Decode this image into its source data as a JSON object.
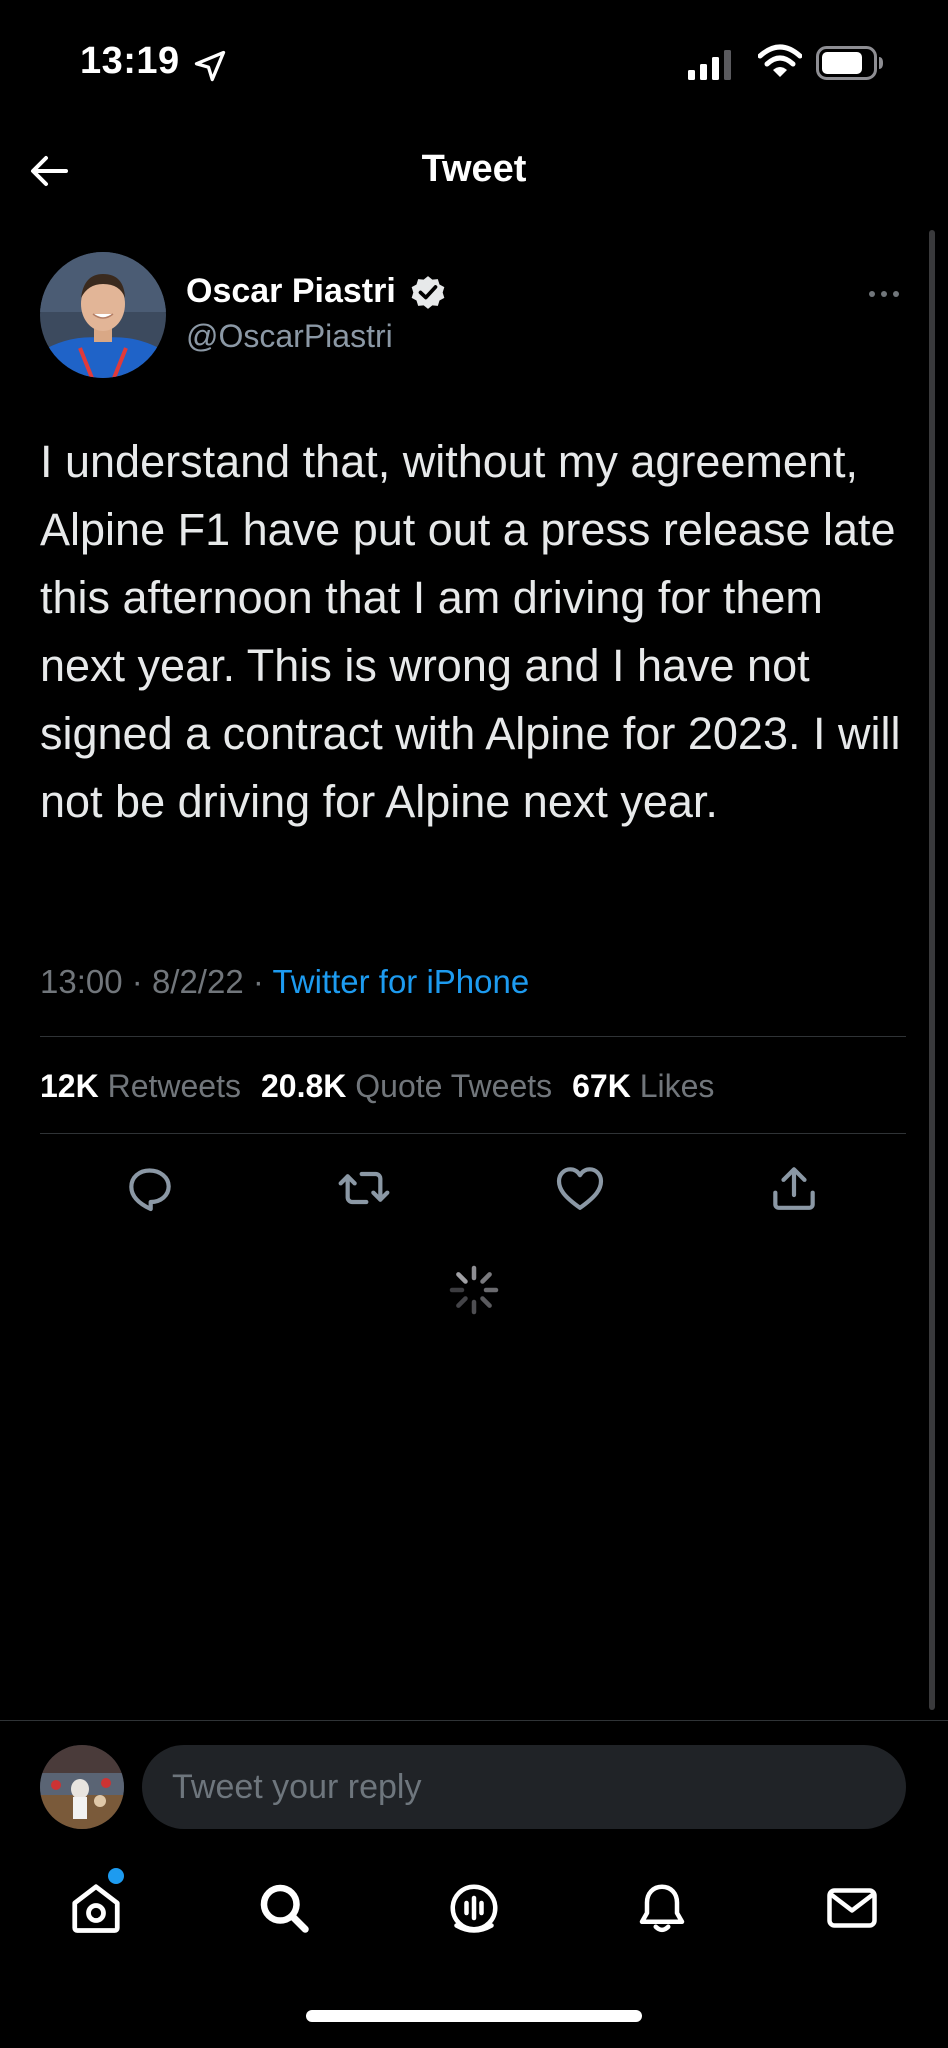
{
  "status_bar": {
    "time": "13:19",
    "icons": [
      "location-arrow-icon",
      "signal-icon",
      "wifi-icon",
      "battery-icon"
    ]
  },
  "nav": {
    "title": "Tweet",
    "back_icon": "back-arrow-icon"
  },
  "tweet": {
    "author_name": "Oscar Piastri",
    "handle": "@OscarPiastri",
    "verified": true,
    "text": "I understand that, without my agreement, Alpine F1 have put out a press release late this afternoon that I am driving for them next year. This is wrong and I have not signed a contract with Alpine for 2023. I will not be driving for Alpine next year.",
    "time": "13:00",
    "date": "8/2/22",
    "separator": "·",
    "source": "Twitter for iPhone",
    "stats": {
      "retweets_count": "12K",
      "retweets_label": "Retweets",
      "quotes_count": "20.8K",
      "quotes_label": "Quote Tweets",
      "likes_count": "67K",
      "likes_label": "Likes"
    },
    "actions": [
      "reply-icon",
      "retweet-icon",
      "like-icon",
      "share-icon"
    ]
  },
  "reply": {
    "placeholder": "Tweet your reply"
  },
  "tab_bar": {
    "tabs": [
      "home-icon",
      "search-icon",
      "spaces-icon",
      "notifications-icon",
      "messages-icon"
    ],
    "home_badge": true
  },
  "colors": {
    "background": "#000000",
    "text": "#e7e9ea",
    "secondary_text": "#71767b",
    "accent": "#1d9bf0"
  }
}
